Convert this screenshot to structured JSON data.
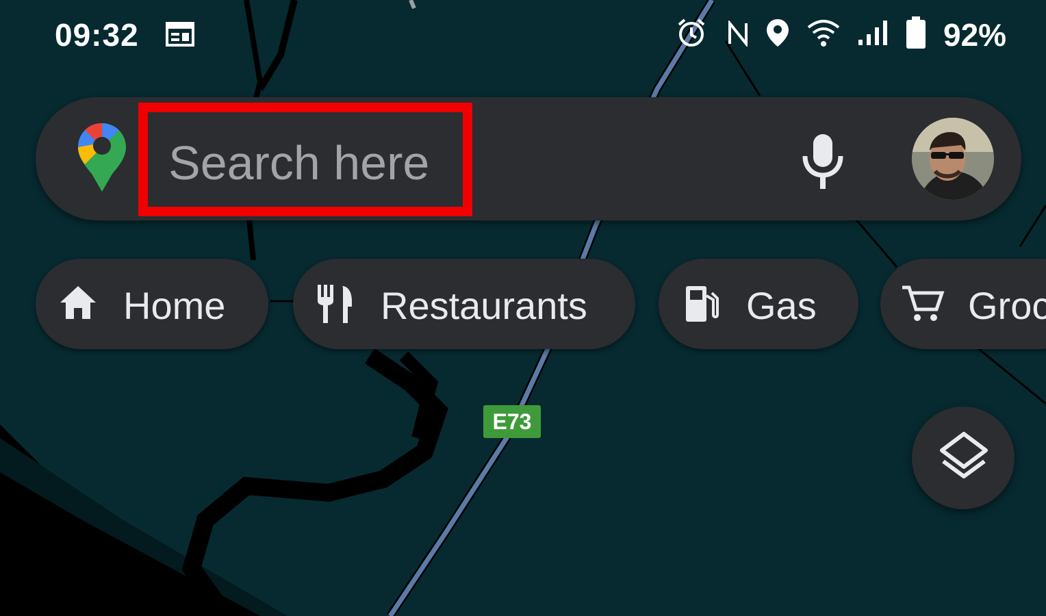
{
  "status_bar": {
    "time": "09:32",
    "battery": "92%",
    "icons": [
      "calendar-icon",
      "alarm-icon",
      "nfc-icon",
      "location-icon",
      "wifi-icon",
      "signal-icon",
      "battery-icon"
    ]
  },
  "search": {
    "placeholder": "Search here",
    "logo": "google-maps-pin-icon",
    "voice_icon": "mic-icon",
    "highlight_color": "#f00000"
  },
  "chips": [
    {
      "label": "Home",
      "icon": "home-icon"
    },
    {
      "label": "Restaurants",
      "icon": "restaurant-icon"
    },
    {
      "label": "Gas",
      "icon": "gas-station-icon"
    },
    {
      "label": "Groc",
      "icon": "cart-icon"
    }
  ],
  "map": {
    "route_shield": "E73",
    "layers_icon": "layers-icon",
    "colors": {
      "water": "#062a30",
      "land": "#000000",
      "highway": "#5a7ba8",
      "shield": "#3f9a3a"
    }
  }
}
